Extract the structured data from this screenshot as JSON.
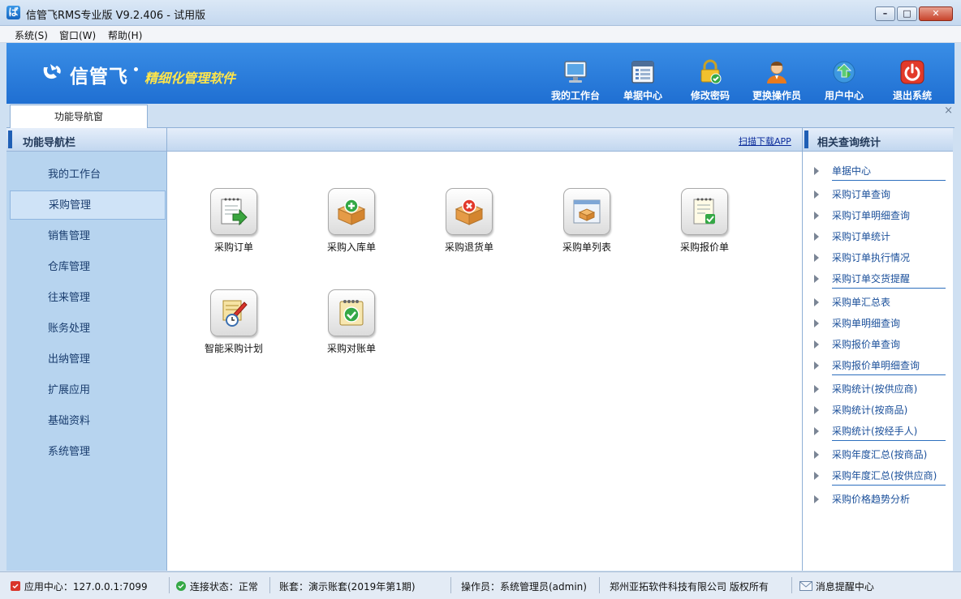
{
  "window": {
    "title": "信管飞RMS专业版 V9.2.406 - 试用版",
    "app_icon_glyph": "ば"
  },
  "menu": {
    "items": [
      "系统(S)",
      "窗口(W)",
      "帮助(H)"
    ]
  },
  "banner": {
    "logo_text": "信管飞",
    "tagline": "精细化管理软件",
    "tools": [
      {
        "label": "我的工作台",
        "icon": "monitor-icon"
      },
      {
        "label": "单据中心",
        "icon": "document-list-icon"
      },
      {
        "label": "修改密码",
        "icon": "lock-check-icon"
      },
      {
        "label": "更换操作员",
        "icon": "user-icon"
      },
      {
        "label": "用户中心",
        "icon": "globe-icon"
      },
      {
        "label": "退出系统",
        "icon": "power-icon"
      }
    ]
  },
  "tabs": {
    "active": "功能导航窗",
    "close_glyph": "×"
  },
  "left_panel": {
    "title": "功能导航栏",
    "items": [
      "我的工作台",
      "采购管理",
      "销售管理",
      "仓库管理",
      "往来管理",
      "账务处理",
      "出纳管理",
      "扩展应用",
      "基础资料",
      "系统管理"
    ],
    "active_index": 1
  },
  "center": {
    "app_link": "扫描下载APP",
    "functions": [
      {
        "label": "采购订单",
        "icon": "order-arrow-icon"
      },
      {
        "label": "采购入库单",
        "icon": "box-plus-icon"
      },
      {
        "label": "采购退货单",
        "icon": "box-cross-icon"
      },
      {
        "label": "采购单列表",
        "icon": "list-window-icon"
      },
      {
        "label": "采购报价单",
        "icon": "notepad-check-icon"
      },
      {
        "label": "智能采购计划",
        "icon": "plan-clock-icon"
      },
      {
        "label": "采购对账单",
        "icon": "notebook-check-icon"
      }
    ]
  },
  "right_panel": {
    "title": "相关查询统计",
    "groups": [
      [
        "单据中心"
      ],
      [
        "采购订单查询",
        "采购订单明细查询",
        "采购订单统计",
        "采购订单执行情况",
        "采购订单交货提醒"
      ],
      [
        "采购单汇总表",
        "采购单明细查询",
        "采购报价单查询",
        "采购报价单明细查询"
      ],
      [
        "采购统计(按供应商)",
        "采购统计(按商品)",
        "采购统计(按经手人)"
      ],
      [
        "采购年度汇总(按商品)",
        "采购年度汇总(按供应商)"
      ],
      [
        "采购价格趋势分析"
      ]
    ]
  },
  "status": {
    "app_center": "应用中心：127.0.0.1:7099",
    "connection": "连接状态：正常",
    "account": "账套：演示账套(2019年第1期)",
    "operator": "操作员：系统管理员(admin)",
    "company": "郑州亚拓软件科技有限公司 版权所有",
    "messages": "消息提醒中心"
  }
}
